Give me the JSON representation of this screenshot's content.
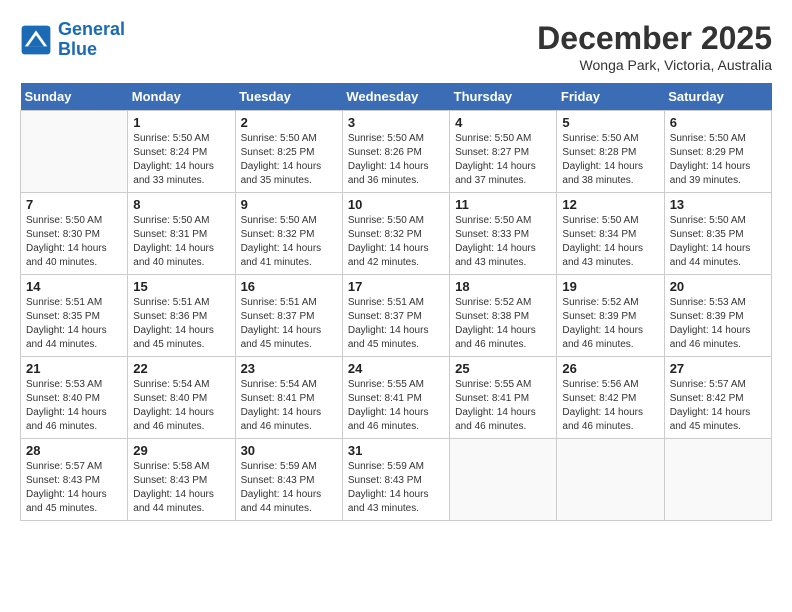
{
  "header": {
    "logo_line1": "General",
    "logo_line2": "Blue",
    "month": "December 2025",
    "location": "Wonga Park, Victoria, Australia"
  },
  "columns": [
    "Sunday",
    "Monday",
    "Tuesday",
    "Wednesday",
    "Thursday",
    "Friday",
    "Saturday"
  ],
  "weeks": [
    [
      {
        "day": "",
        "info": ""
      },
      {
        "day": "1",
        "info": "Sunrise: 5:50 AM\nSunset: 8:24 PM\nDaylight: 14 hours\nand 33 minutes."
      },
      {
        "day": "2",
        "info": "Sunrise: 5:50 AM\nSunset: 8:25 PM\nDaylight: 14 hours\nand 35 minutes."
      },
      {
        "day": "3",
        "info": "Sunrise: 5:50 AM\nSunset: 8:26 PM\nDaylight: 14 hours\nand 36 minutes."
      },
      {
        "day": "4",
        "info": "Sunrise: 5:50 AM\nSunset: 8:27 PM\nDaylight: 14 hours\nand 37 minutes."
      },
      {
        "day": "5",
        "info": "Sunrise: 5:50 AM\nSunset: 8:28 PM\nDaylight: 14 hours\nand 38 minutes."
      },
      {
        "day": "6",
        "info": "Sunrise: 5:50 AM\nSunset: 8:29 PM\nDaylight: 14 hours\nand 39 minutes."
      }
    ],
    [
      {
        "day": "7",
        "info": "Sunrise: 5:50 AM\nSunset: 8:30 PM\nDaylight: 14 hours\nand 40 minutes."
      },
      {
        "day": "8",
        "info": "Sunrise: 5:50 AM\nSunset: 8:31 PM\nDaylight: 14 hours\nand 40 minutes."
      },
      {
        "day": "9",
        "info": "Sunrise: 5:50 AM\nSunset: 8:32 PM\nDaylight: 14 hours\nand 41 minutes."
      },
      {
        "day": "10",
        "info": "Sunrise: 5:50 AM\nSunset: 8:32 PM\nDaylight: 14 hours\nand 42 minutes."
      },
      {
        "day": "11",
        "info": "Sunrise: 5:50 AM\nSunset: 8:33 PM\nDaylight: 14 hours\nand 43 minutes."
      },
      {
        "day": "12",
        "info": "Sunrise: 5:50 AM\nSunset: 8:34 PM\nDaylight: 14 hours\nand 43 minutes."
      },
      {
        "day": "13",
        "info": "Sunrise: 5:50 AM\nSunset: 8:35 PM\nDaylight: 14 hours\nand 44 minutes."
      }
    ],
    [
      {
        "day": "14",
        "info": "Sunrise: 5:51 AM\nSunset: 8:35 PM\nDaylight: 14 hours\nand 44 minutes."
      },
      {
        "day": "15",
        "info": "Sunrise: 5:51 AM\nSunset: 8:36 PM\nDaylight: 14 hours\nand 45 minutes."
      },
      {
        "day": "16",
        "info": "Sunrise: 5:51 AM\nSunset: 8:37 PM\nDaylight: 14 hours\nand 45 minutes."
      },
      {
        "day": "17",
        "info": "Sunrise: 5:51 AM\nSunset: 8:37 PM\nDaylight: 14 hours\nand 45 minutes."
      },
      {
        "day": "18",
        "info": "Sunrise: 5:52 AM\nSunset: 8:38 PM\nDaylight: 14 hours\nand 46 minutes."
      },
      {
        "day": "19",
        "info": "Sunrise: 5:52 AM\nSunset: 8:39 PM\nDaylight: 14 hours\nand 46 minutes."
      },
      {
        "day": "20",
        "info": "Sunrise: 5:53 AM\nSunset: 8:39 PM\nDaylight: 14 hours\nand 46 minutes."
      }
    ],
    [
      {
        "day": "21",
        "info": "Sunrise: 5:53 AM\nSunset: 8:40 PM\nDaylight: 14 hours\nand 46 minutes."
      },
      {
        "day": "22",
        "info": "Sunrise: 5:54 AM\nSunset: 8:40 PM\nDaylight: 14 hours\nand 46 minutes."
      },
      {
        "day": "23",
        "info": "Sunrise: 5:54 AM\nSunset: 8:41 PM\nDaylight: 14 hours\nand 46 minutes."
      },
      {
        "day": "24",
        "info": "Sunrise: 5:55 AM\nSunset: 8:41 PM\nDaylight: 14 hours\nand 46 minutes."
      },
      {
        "day": "25",
        "info": "Sunrise: 5:55 AM\nSunset: 8:41 PM\nDaylight: 14 hours\nand 46 minutes."
      },
      {
        "day": "26",
        "info": "Sunrise: 5:56 AM\nSunset: 8:42 PM\nDaylight: 14 hours\nand 46 minutes."
      },
      {
        "day": "27",
        "info": "Sunrise: 5:57 AM\nSunset: 8:42 PM\nDaylight: 14 hours\nand 45 minutes."
      }
    ],
    [
      {
        "day": "28",
        "info": "Sunrise: 5:57 AM\nSunset: 8:43 PM\nDaylight: 14 hours\nand 45 minutes."
      },
      {
        "day": "29",
        "info": "Sunrise: 5:58 AM\nSunset: 8:43 PM\nDaylight: 14 hours\nand 44 minutes."
      },
      {
        "day": "30",
        "info": "Sunrise: 5:59 AM\nSunset: 8:43 PM\nDaylight: 14 hours\nand 44 minutes."
      },
      {
        "day": "31",
        "info": "Sunrise: 5:59 AM\nSunset: 8:43 PM\nDaylight: 14 hours\nand 43 minutes."
      },
      {
        "day": "",
        "info": ""
      },
      {
        "day": "",
        "info": ""
      },
      {
        "day": "",
        "info": ""
      }
    ]
  ]
}
